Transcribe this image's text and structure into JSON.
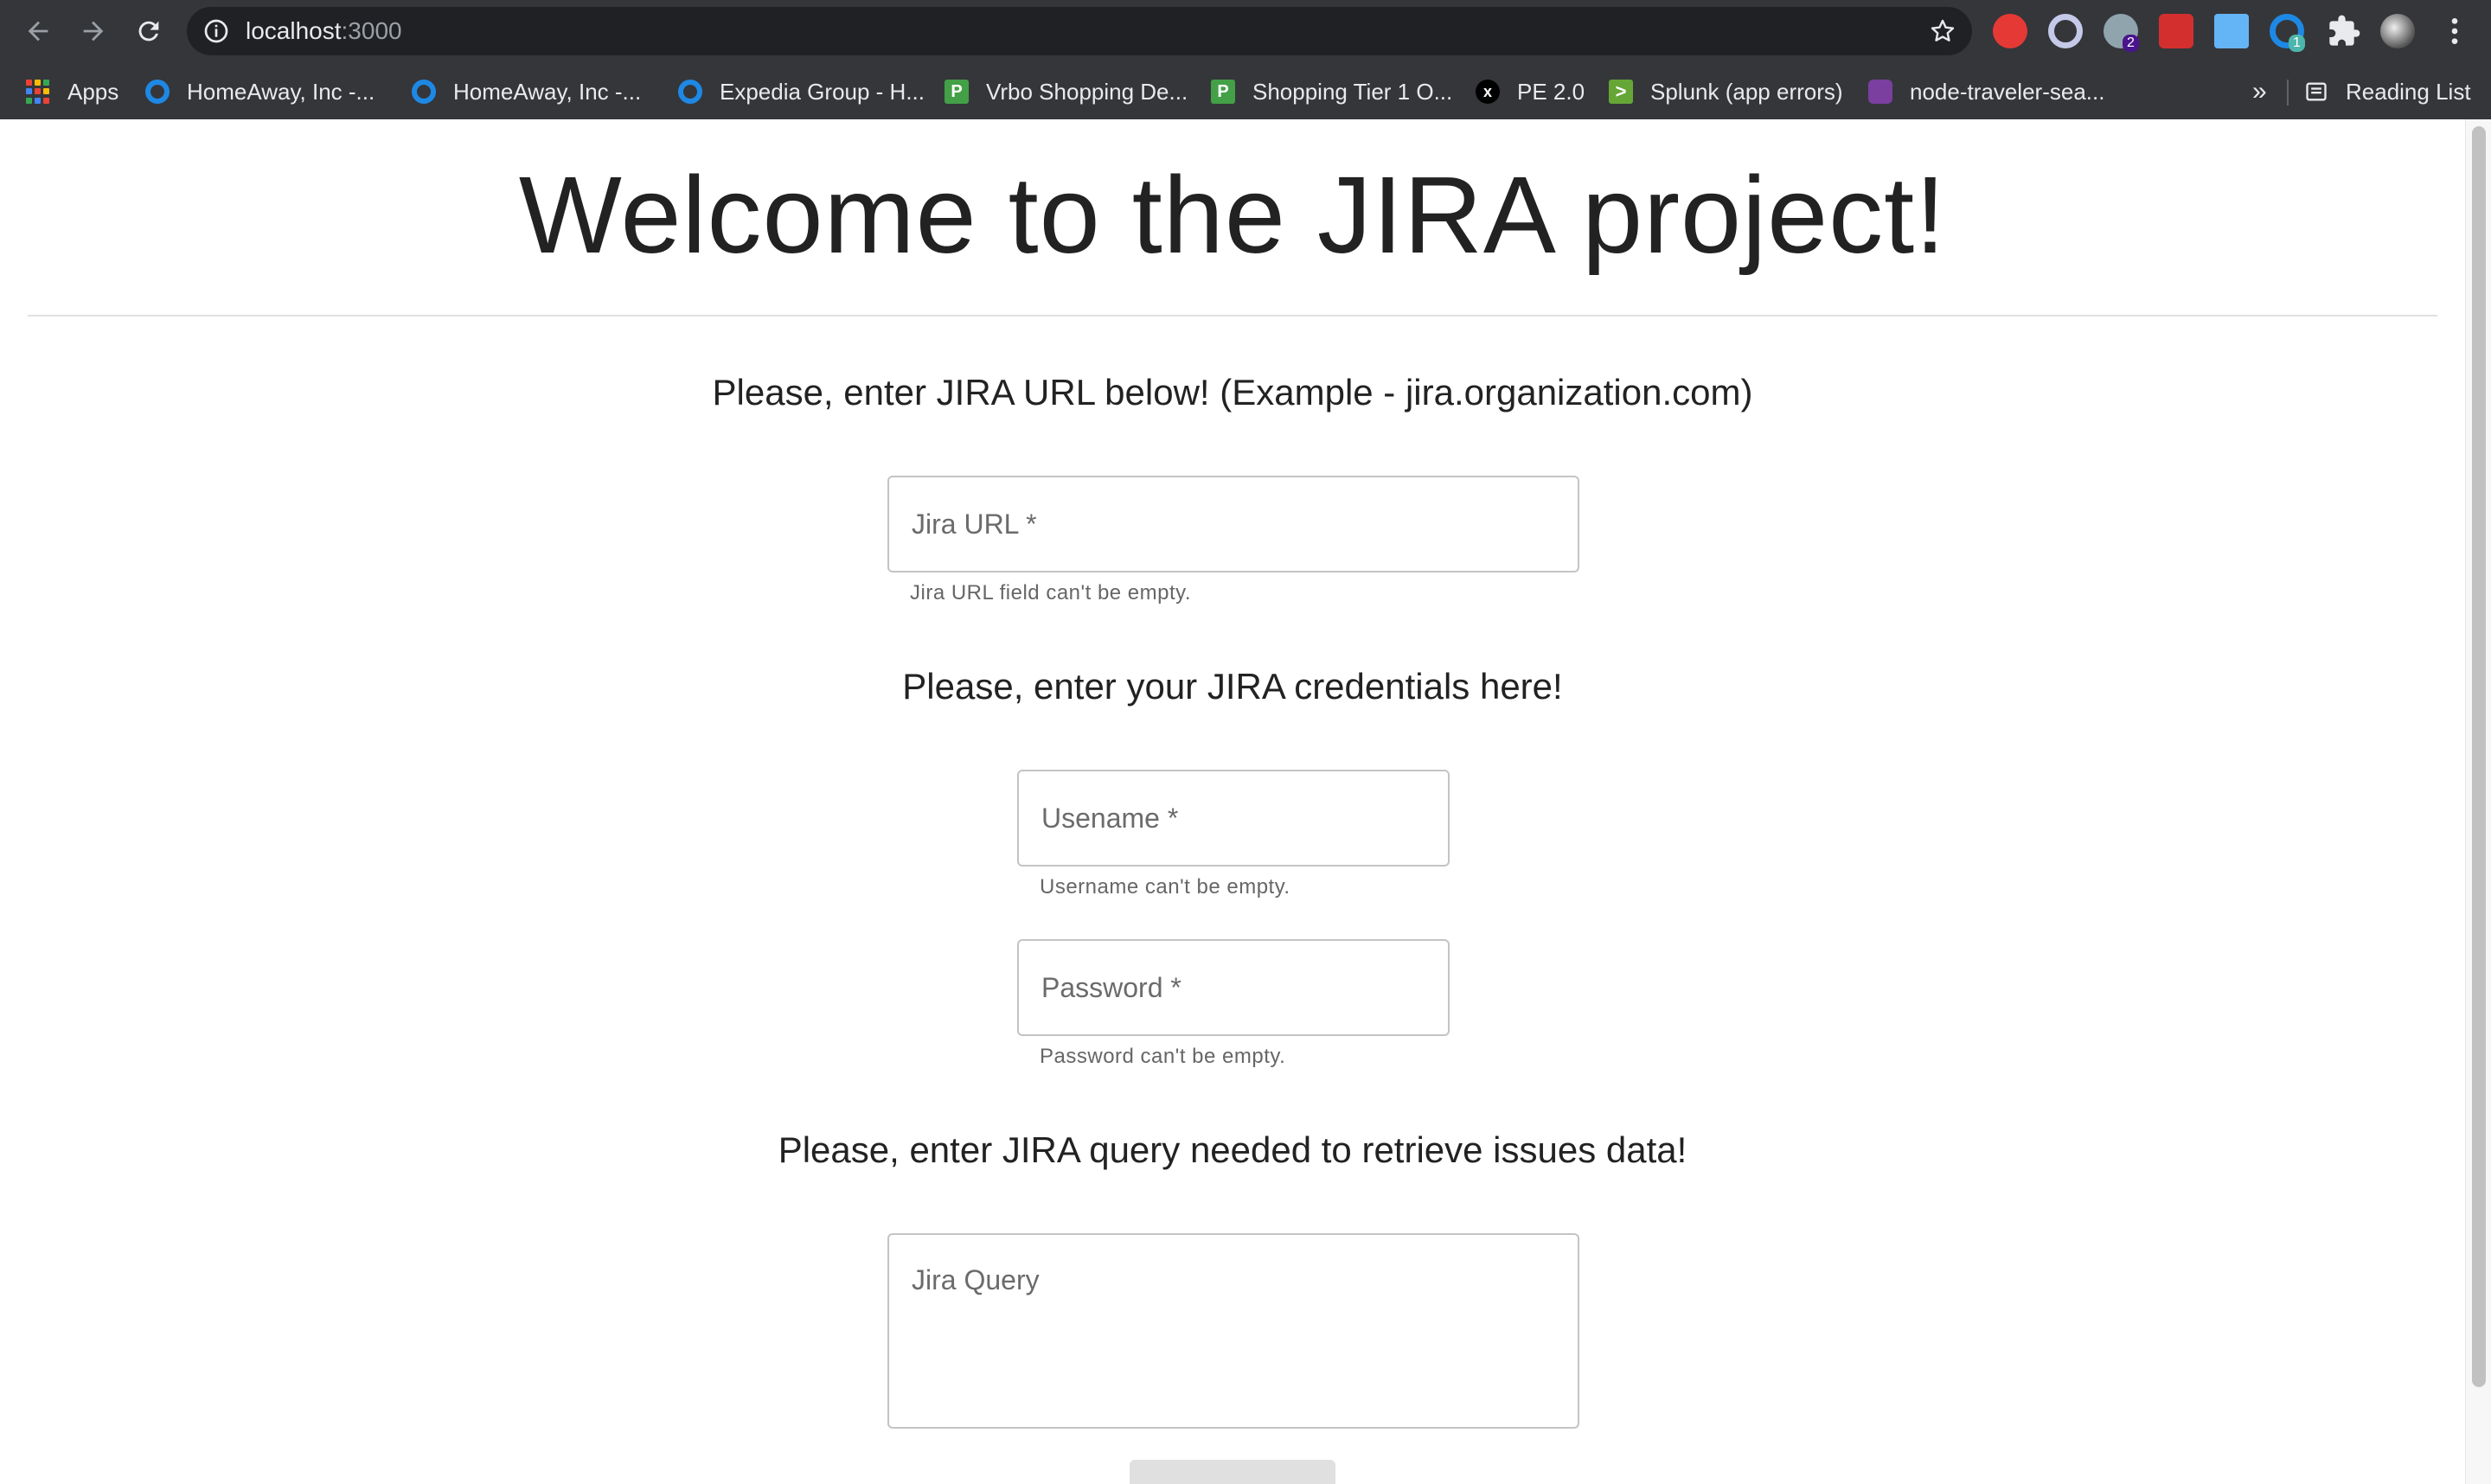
{
  "browser": {
    "url_host": "localhost",
    "url_port": ":3000",
    "extensions": [
      {
        "name": "adblock-icon",
        "color": "#e53935"
      },
      {
        "name": "ring-extension-icon",
        "color": "#c5cae9"
      },
      {
        "name": "globe-extension-icon",
        "color": "#90a4ae",
        "badge": "2"
      },
      {
        "name": "red-square-extension-icon",
        "color": "#d32f2f"
      },
      {
        "name": "document-extension-icon",
        "color": "#64b5f6"
      },
      {
        "name": "blue-ring-extension-icon",
        "color": "#1e88e5",
        "badge": "1"
      },
      {
        "name": "puzzle-icon",
        "color": "#e8eaed"
      },
      {
        "name": "avatar",
        "color": "#9e9e9e"
      },
      {
        "name": "menu-icon",
        "color": "#e8eaed"
      }
    ]
  },
  "bookmarks": {
    "apps": "Apps",
    "items": [
      {
        "label": "HomeAway, Inc -...",
        "icon": "ring"
      },
      {
        "label": "HomeAway, Inc -...",
        "icon": "ring"
      },
      {
        "label": "Expedia Group - H...",
        "icon": "ring"
      },
      {
        "label": "Vrbo Shopping De...",
        "icon": "p"
      },
      {
        "label": "Shopping Tier 1 O...",
        "icon": "p"
      },
      {
        "label": "PE 2.0",
        "icon": "x"
      },
      {
        "label": "Splunk (app errors)",
        "icon": "splunk"
      },
      {
        "label": "node-traveler-sea...",
        "icon": "node"
      }
    ],
    "overflow": "»",
    "reading_list": "Reading List"
  },
  "page": {
    "title": "Welcome to the JIRA project!",
    "url_heading": "Please, enter JIRA URL below! (Example - jira.organization.com)",
    "jira_url": {
      "label": "Jira URL *",
      "helper": "Jira URL field can't be empty."
    },
    "credentials_heading": "Please, enter your JIRA credentials here!",
    "username": {
      "label": "Usename *",
      "helper": "Username can't be empty."
    },
    "password": {
      "label": "Password *",
      "helper": "Password can't be empty."
    },
    "query_heading": "Please, enter JIRA query needed to retrieve issues data!",
    "jira_query": {
      "label": "Jira Query"
    }
  }
}
